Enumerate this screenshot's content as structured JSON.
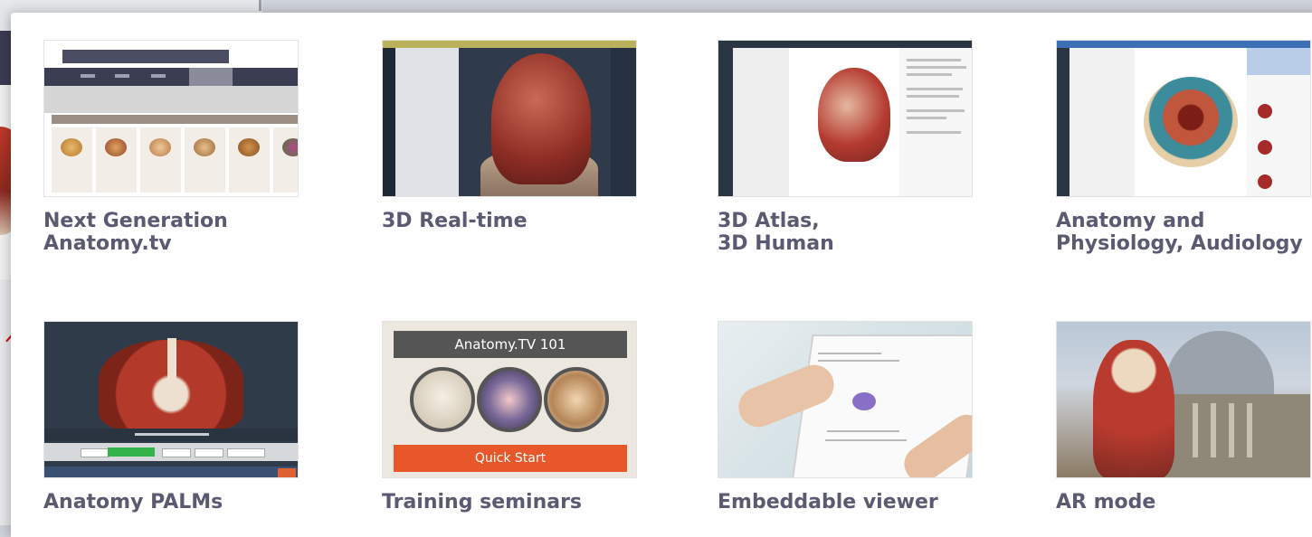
{
  "cards": [
    {
      "title_line1": "Next Generation",
      "title_line2": "Anatomy.tv"
    },
    {
      "title_line1": "3D Real-time",
      "title_line2": ""
    },
    {
      "title_line1": "3D Atlas,",
      "title_line2": "3D Human"
    },
    {
      "title_line1": "Anatomy and",
      "title_line2": "Physiology, Audiology"
    },
    {
      "title_line1": "Anatomy PALMs",
      "title_line2": ""
    },
    {
      "title_line1": "Training seminars",
      "title_line2": ""
    },
    {
      "title_line1": "Embeddable viewer",
      "title_line2": ""
    },
    {
      "title_line1": "AR mode",
      "title_line2": ""
    }
  ],
  "training": {
    "banner": "Anatomy.TV 101",
    "cta": "Quick Start"
  },
  "colors": {
    "title": "#5a5a72",
    "accent_orange": "#e8572a",
    "panel": "#ffffff"
  }
}
